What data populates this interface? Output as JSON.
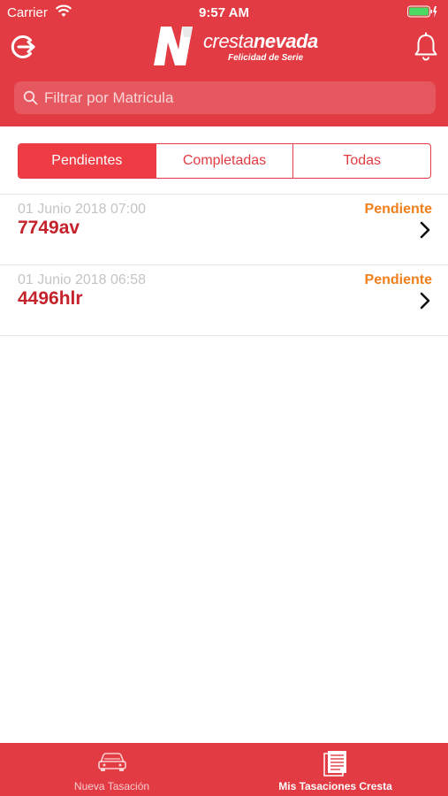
{
  "status_bar": {
    "carrier": "Carrier",
    "time": "9:57 AM"
  },
  "header": {
    "brand_light": "cresta",
    "brand_bold": "nevada",
    "tagline": "Felicidad de Serie",
    "logo_letter": "N"
  },
  "search": {
    "placeholder": "Filtrar por Matricula",
    "value": ""
  },
  "segments": [
    {
      "label": "Pendientes",
      "selected": true
    },
    {
      "label": "Completadas",
      "selected": false
    },
    {
      "label": "Todas",
      "selected": false
    }
  ],
  "appraisals": [
    {
      "date": "01 Junio 2018 07:00",
      "plate": "7749av",
      "status": "Pendiente"
    },
    {
      "date": "01 Junio 2018 06:58",
      "plate": "4496hlr",
      "status": "Pendiente"
    }
  ],
  "tabbar": {
    "tabs": [
      {
        "label": "Nueva Tasación",
        "icon": "car-icon",
        "selected": false
      },
      {
        "label": "Mis Tasaciones Cresta",
        "icon": "document-list-icon",
        "selected": true
      }
    ]
  },
  "colors": {
    "brand_red": "#e23b43",
    "plate_red": "#c4232b",
    "status_orange": "#f07f1c",
    "date_gray": "#c4c4c4",
    "battery_green": "#4cd964"
  }
}
